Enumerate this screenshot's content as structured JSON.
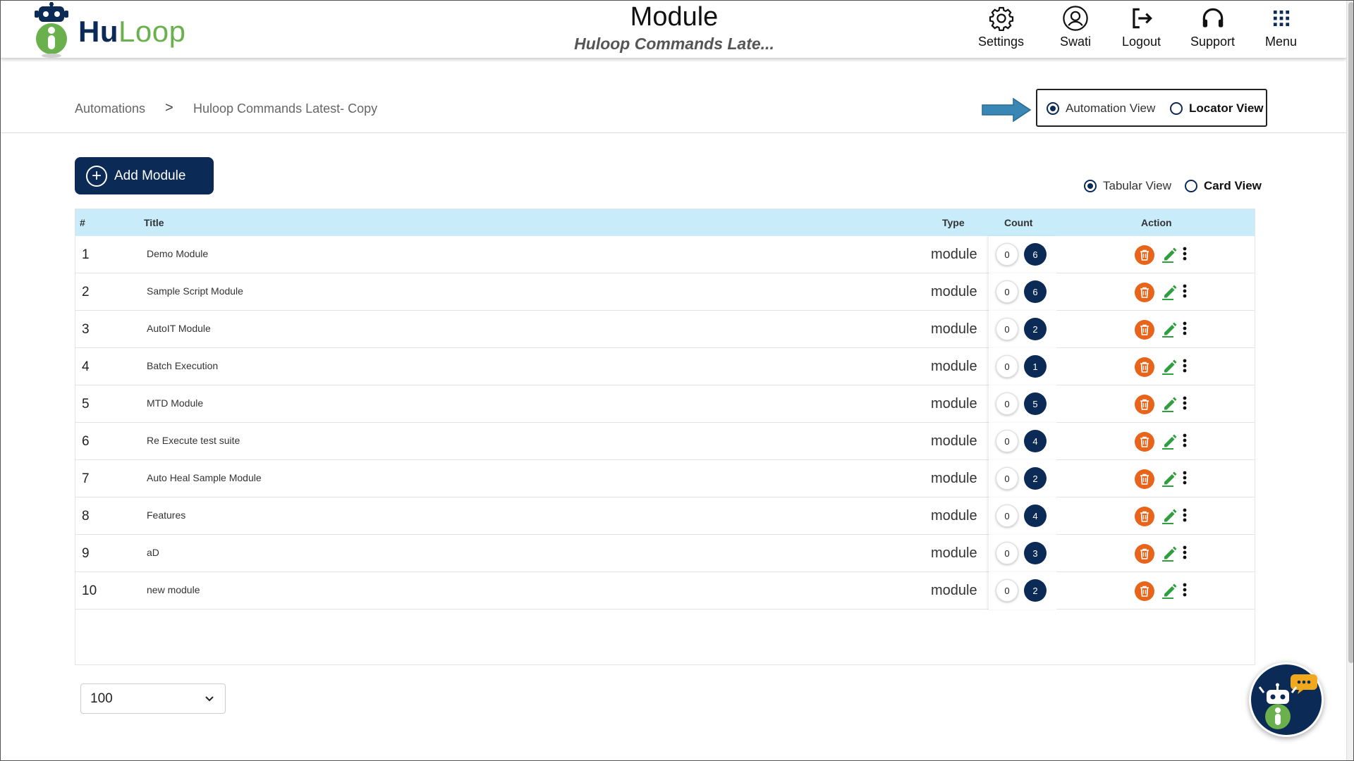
{
  "header": {
    "logo": {
      "hu": "Hu",
      "loop": "Loop"
    },
    "title": "Module",
    "subtitle": "Huloop Commands Late...",
    "nav": [
      {
        "label": "Settings",
        "icon": "gear-icon"
      },
      {
        "label": "Swati",
        "icon": "user-avatar-icon"
      },
      {
        "label": "Logout",
        "icon": "logout-icon"
      },
      {
        "label": "Support",
        "icon": "headset-icon"
      },
      {
        "label": "Menu",
        "icon": "grid-menu-icon"
      }
    ]
  },
  "breadcrumb": {
    "items": [
      "Automations",
      "Huloop Commands Latest- Copy"
    ],
    "separator": ">"
  },
  "view_mode": {
    "options": [
      {
        "label": "Automation View",
        "selected": true
      },
      {
        "label": "Locator View",
        "selected": false
      }
    ]
  },
  "layout_mode": {
    "options": [
      {
        "label": "Tabular View",
        "selected": true
      },
      {
        "label": "Card View",
        "selected": false
      }
    ]
  },
  "add_button": {
    "label": "Add Module"
  },
  "table": {
    "columns": [
      "#",
      "Title",
      "Type",
      "Count",
      "Action"
    ],
    "rows": [
      {
        "num": "1",
        "title": "Demo Module",
        "type": "module",
        "count_zero": "0",
        "count_total": "6"
      },
      {
        "num": "2",
        "title": "Sample Script Module",
        "type": "module",
        "count_zero": "0",
        "count_total": "6"
      },
      {
        "num": "3",
        "title": "AutoIT Module",
        "type": "module",
        "count_zero": "0",
        "count_total": "2"
      },
      {
        "num": "4",
        "title": "Batch Execution",
        "type": "module",
        "count_zero": "0",
        "count_total": "1"
      },
      {
        "num": "5",
        "title": "MTD Module",
        "type": "module",
        "count_zero": "0",
        "count_total": "5"
      },
      {
        "num": "6",
        "title": "Re Execute test suite",
        "type": "module",
        "count_zero": "0",
        "count_total": "4"
      },
      {
        "num": "7",
        "title": "Auto Heal Sample Module",
        "type": "module",
        "count_zero": "0",
        "count_total": "2"
      },
      {
        "num": "8",
        "title": "Features",
        "type": "module",
        "count_zero": "0",
        "count_total": "4"
      },
      {
        "num": "9",
        "title": "aD",
        "type": "module",
        "count_zero": "0",
        "count_total": "3"
      },
      {
        "num": "10",
        "title": "new module",
        "type": "module",
        "count_zero": "0",
        "count_total": "2"
      }
    ],
    "action_icons": [
      "delete-icon",
      "edit-icon",
      "more-options-icon"
    ]
  },
  "page_size": {
    "value": "100"
  },
  "colors": {
    "brand_navy": "#0b2a55",
    "brand_green": "#6ab04c",
    "table_header_bg": "#c9ecfb",
    "delete_orange": "#e8641b",
    "edit_green": "#2e9e3e",
    "arrow_blue": "#3a86b4"
  }
}
